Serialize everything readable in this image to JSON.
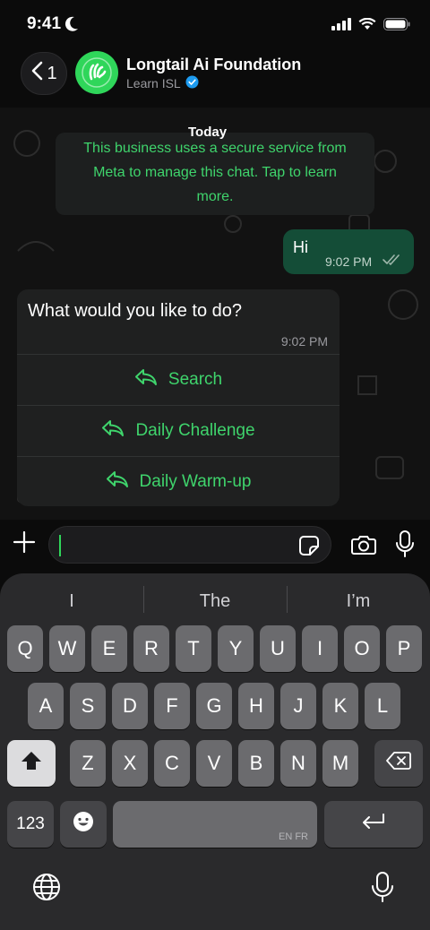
{
  "status_bar": {
    "time": "9:41"
  },
  "header": {
    "back_count": "1",
    "contact_name": "Longtail Ai Foundation",
    "contact_subtitle": "Learn ISL"
  },
  "chat": {
    "date_label": "Today",
    "notice_lines": [
      "This business uses a secure service from",
      "Meta to manage this chat. Tap to learn",
      "more."
    ],
    "outgoing": {
      "text": "Hi",
      "time": "9:02 PM"
    },
    "incoming": {
      "text": "What would you like to do?",
      "time": "9:02 PM",
      "buttons": [
        "Search",
        "Daily Challenge",
        "Daily Warm-up"
      ]
    }
  },
  "composer": {
    "value": ""
  },
  "keyboard": {
    "suggestions": [
      "I",
      "The",
      "I’m"
    ],
    "row1": [
      "Q",
      "W",
      "E",
      "R",
      "T",
      "Y",
      "U",
      "I",
      "O",
      "P"
    ],
    "row2": [
      "A",
      "S",
      "D",
      "F",
      "G",
      "H",
      "J",
      "K",
      "L"
    ],
    "row3": [
      "Z",
      "X",
      "C",
      "V",
      "B",
      "N",
      "M"
    ],
    "numbers_key": "123",
    "space_languages": "EN FR"
  },
  "colors": {
    "accent": "#3fd46c",
    "outgoing_bubble": "#144d37",
    "avatar": "#2fd65a"
  },
  "icons": [
    "moon-icon",
    "signal-icon",
    "wifi-icon",
    "battery-icon",
    "chevron-left-icon",
    "verified-badge-icon",
    "reply-icon",
    "plus-icon",
    "sticker-icon",
    "camera-icon",
    "microphone-icon",
    "shift-icon",
    "backspace-icon",
    "emoji-icon",
    "return-icon",
    "globe-icon",
    "double-check-icon"
  ]
}
